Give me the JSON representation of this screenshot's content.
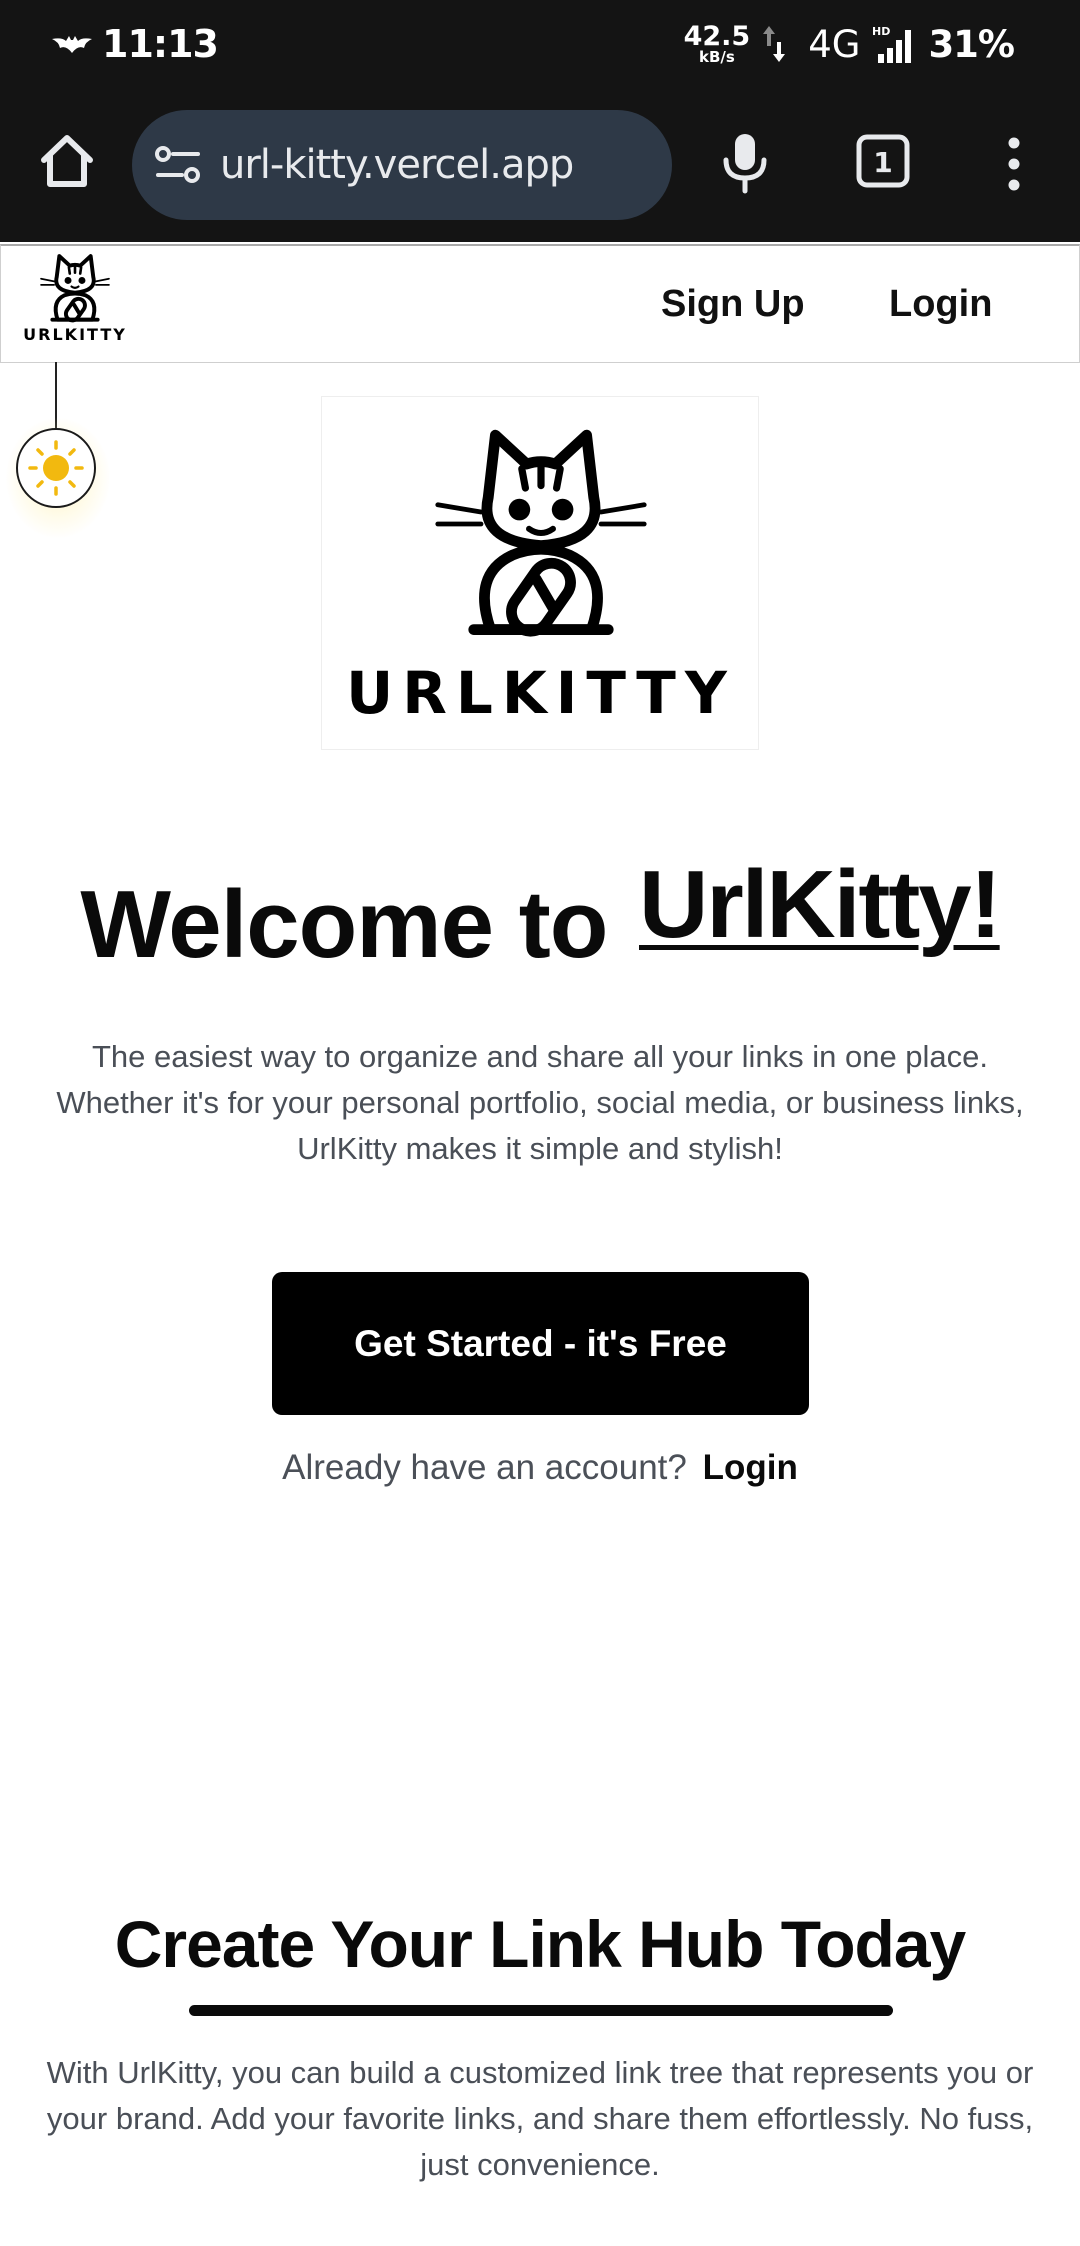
{
  "status_bar": {
    "time": "11:13",
    "net_speed": "42.5",
    "net_speed_unit": "kB/s",
    "network": "4G",
    "hd_badge": "HD",
    "battery": "31%"
  },
  "browser": {
    "url": "url-kitty.vercel.app",
    "tab_count": "1",
    "icons": [
      "home-icon",
      "site-settings-icon",
      "mic-icon",
      "tab-switcher-icon",
      "more-menu-icon"
    ]
  },
  "header": {
    "brand": "URLKITTY",
    "nav": {
      "signup": "Sign Up",
      "login": "Login"
    }
  },
  "hero": {
    "logo_word": "URLKITTY",
    "welcome_prefix": "Welcome to ",
    "welcome_brand": "UrlKitty!",
    "intro": "The easiest way to organize and share all your links in one place. Whether it's for your personal portfolio, social media, or business links, UrlKitty makes it simple and stylish!",
    "cta": "Get Started - it's Free",
    "account_prompt": "Already have an account?",
    "account_login": "Login"
  },
  "section": {
    "title": "Create Your Link Hub Today",
    "text": "With UrlKitty, you can build a customized link tree that represents you or your brand. Add your favorite links, and share them effortlessly. No fuss, just convenience."
  },
  "colors": {
    "status_bg": "#141414",
    "urlbar_bg": "#2e3947",
    "cta_bg": "#000000",
    "body_text": "#4a4f57",
    "sun": "#f2b90f"
  }
}
